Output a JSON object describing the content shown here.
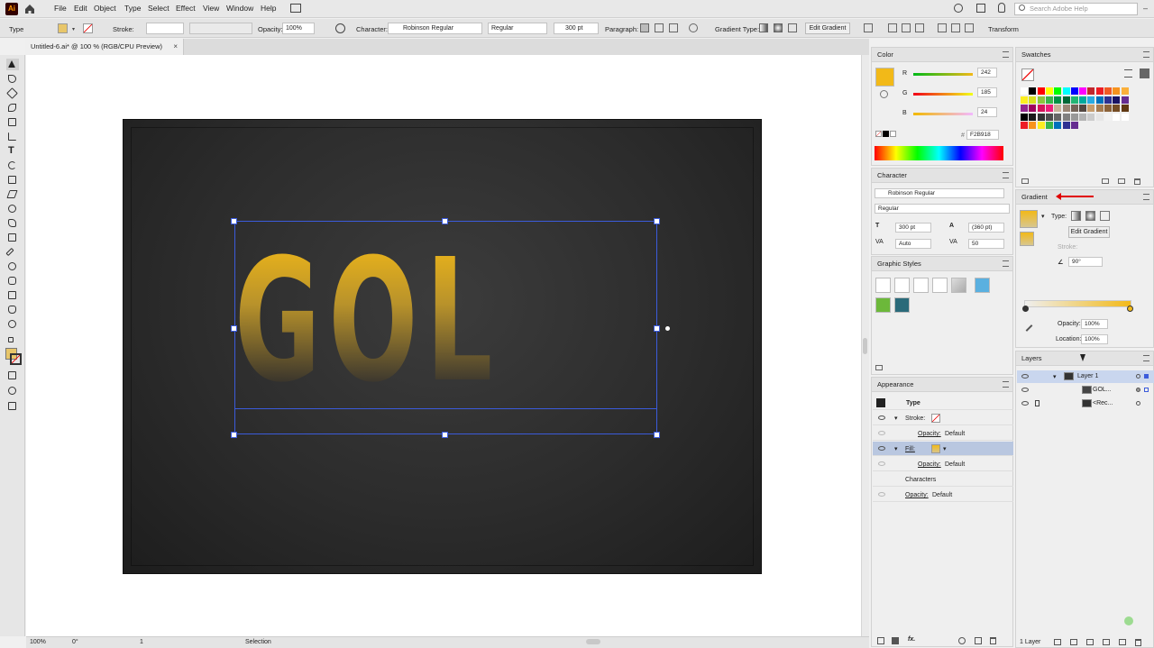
{
  "menubar": {
    "logo": "Ai",
    "items": [
      "File",
      "Edit",
      "Object",
      "Type",
      "Select",
      "Effect",
      "View",
      "Window",
      "Help"
    ],
    "search_placeholder": "Search Adobe Help"
  },
  "controlbar": {
    "tool_name": "Type",
    "stroke_label": "Stroke:",
    "opacity_label": "Opacity:",
    "opacity_value": "100%",
    "character_label": "Character:",
    "font_family": "Robinson Regular",
    "font_style": "Regular",
    "font_size": "300 pt",
    "paragraph_label": "Paragraph:",
    "gradient_type_label": "Gradient Type:",
    "edit_gradient": "Edit Gradient",
    "transform_label": "Transform"
  },
  "document": {
    "tab_title": "Untitled-6.ai* @ 100 % (RGB/CPU Preview)",
    "close": "×",
    "art_text": "GOLDEN"
  },
  "statusbar": {
    "zoom": "100%",
    "rotation": "0°",
    "artboard": "1",
    "tool": "Selection"
  },
  "color_panel": {
    "title": "Color",
    "r_label": "R",
    "r_value": "242",
    "g_label": "G",
    "g_value": "185",
    "b_label": "B",
    "b_value": "24",
    "hex": "F2B918",
    "fill_color": "#f2b918"
  },
  "character_panel": {
    "title": "Character",
    "font_family": "Robinson Regular",
    "font_style": "Regular",
    "size": "300 pt",
    "leading": "(360 pt)",
    "kerning": "Auto",
    "tracking": "50"
  },
  "graphic_styles_panel": {
    "title": "Graphic Styles"
  },
  "appearance_panel": {
    "title": "Appearance",
    "type_label": "Type",
    "stroke_label": "Stroke:",
    "opacity_label": "Opacity:",
    "opacity_value": "Default",
    "fill_label": "Fill:",
    "characters_label": "Characters"
  },
  "swatches_panel": {
    "title": "Swatches"
  },
  "gradient_panel": {
    "title": "Gradient",
    "type_label": "Type:",
    "edit_gradient": "Edit Gradient",
    "stroke_label": "Stroke:",
    "angle": "90°",
    "opacity_label": "Opacity:",
    "opacity_value": "100%",
    "location_label": "Location:",
    "location_value": "100%"
  },
  "layers_panel": {
    "title": "Layers",
    "rows": [
      {
        "name": "Layer 1"
      },
      {
        "name": "GOL..."
      },
      {
        "name": "<Rec..."
      }
    ],
    "footer": "1 Layer"
  }
}
